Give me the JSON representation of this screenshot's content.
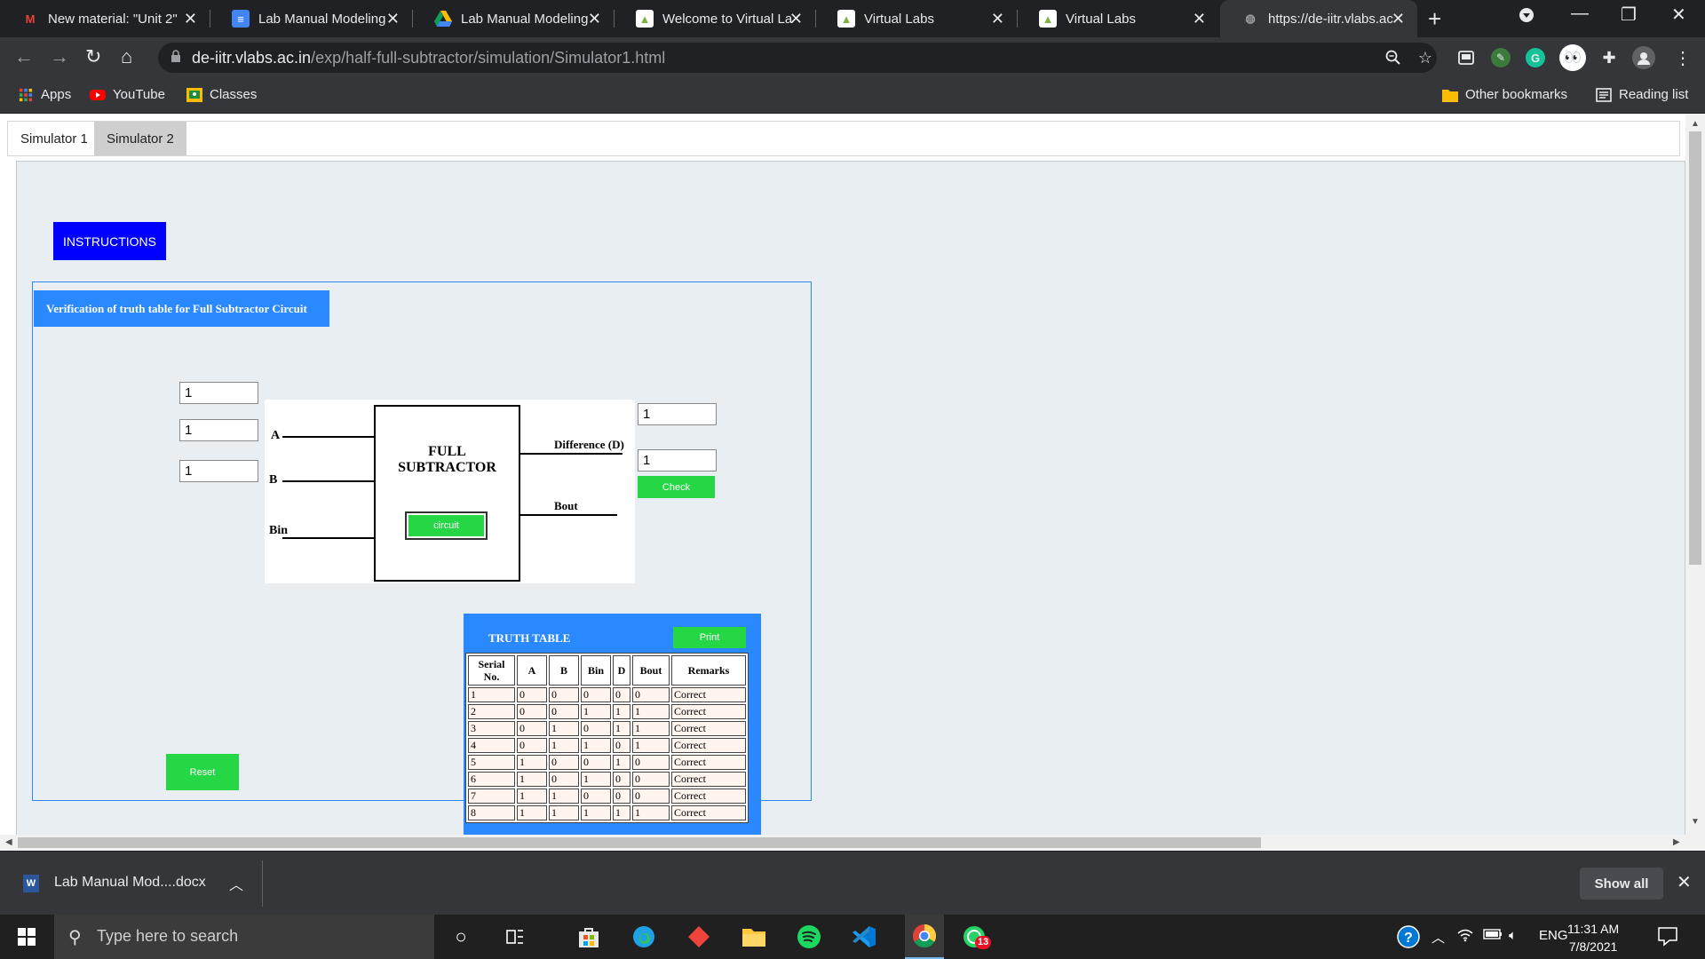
{
  "browser": {
    "tabs": [
      {
        "title": "New material: \"Unit 2\"",
        "icon": "gmail-icon",
        "color": "#ea4335"
      },
      {
        "title": "Lab Manual Modeling",
        "icon": "google-docs-icon",
        "color": "#4285f4"
      },
      {
        "title": "Lab Manual Modeling",
        "icon": "google-drive-icon",
        "color": "#fbbc04"
      },
      {
        "title": "Welcome to Virtual La",
        "icon": "virtual-labs-icon",
        "color": "#7cb342"
      },
      {
        "title": "Virtual Labs",
        "icon": "virtual-labs-icon",
        "color": "#7cb342"
      },
      {
        "title": "Virtual Labs",
        "icon": "virtual-labs-icon",
        "color": "#7cb342"
      },
      {
        "title": "https://de-iitr.vlabs.ac",
        "icon": "globe-icon",
        "color": "#9aa0a6",
        "active": true
      }
    ],
    "url_host": "de-iitr.vlabs.ac.in",
    "url_path": "/exp/half-full-subtractor/simulation/Simulator1.html",
    "bookmarks": [
      "Apps",
      "YouTube",
      "Classes"
    ],
    "other_bookmarks": "Other bookmarks",
    "reading_list": "Reading list"
  },
  "page": {
    "sim_tabs": [
      "Simulator 1",
      "Simulator 2"
    ],
    "instructions_label": "INSTRUCTIONS",
    "frame_title": "Verification of truth table for Full Subtractor Circuit",
    "inputs": {
      "a": "1",
      "b": "1",
      "bin": "1"
    },
    "outputs": {
      "difference": "1",
      "bout": "1"
    },
    "diagram": {
      "label_a": "A",
      "label_b": "B",
      "label_bin": "Bin",
      "block_line1": "FULL",
      "block_line2": "SUBTRACTOR",
      "circuit_button": "circuit",
      "label_difference": "Difference (D)",
      "label_bout": "Bout"
    },
    "check_label": "Check",
    "reset_label": "Reset",
    "truth_table": {
      "title": "TRUTH TABLE",
      "print_label": "Print",
      "headers": [
        "Serial No.",
        "A",
        "B",
        "Bin",
        "D",
        "Bout",
        "Remarks"
      ],
      "rows": [
        [
          "1",
          "0",
          "0",
          "0",
          "0",
          "0",
          "Correct"
        ],
        [
          "2",
          "0",
          "0",
          "1",
          "1",
          "1",
          "Correct"
        ],
        [
          "3",
          "0",
          "1",
          "0",
          "1",
          "1",
          "Correct"
        ],
        [
          "4",
          "0",
          "1",
          "1",
          "0",
          "1",
          "Correct"
        ],
        [
          "5",
          "1",
          "0",
          "0",
          "1",
          "0",
          "Correct"
        ],
        [
          "6",
          "1",
          "0",
          "1",
          "0",
          "0",
          "Correct"
        ],
        [
          "7",
          "1",
          "1",
          "0",
          "0",
          "0",
          "Correct"
        ],
        [
          "8",
          "1",
          "1",
          "1",
          "1",
          "1",
          "Correct"
        ]
      ]
    }
  },
  "download": {
    "file": "Lab Manual Mod....docx",
    "show_all": "Show all"
  },
  "taskbar": {
    "search_placeholder": "Type here to search",
    "language": "ENG",
    "time": "11:31 AM",
    "date": "7/8/2021",
    "whatsapp_badge": "13"
  }
}
